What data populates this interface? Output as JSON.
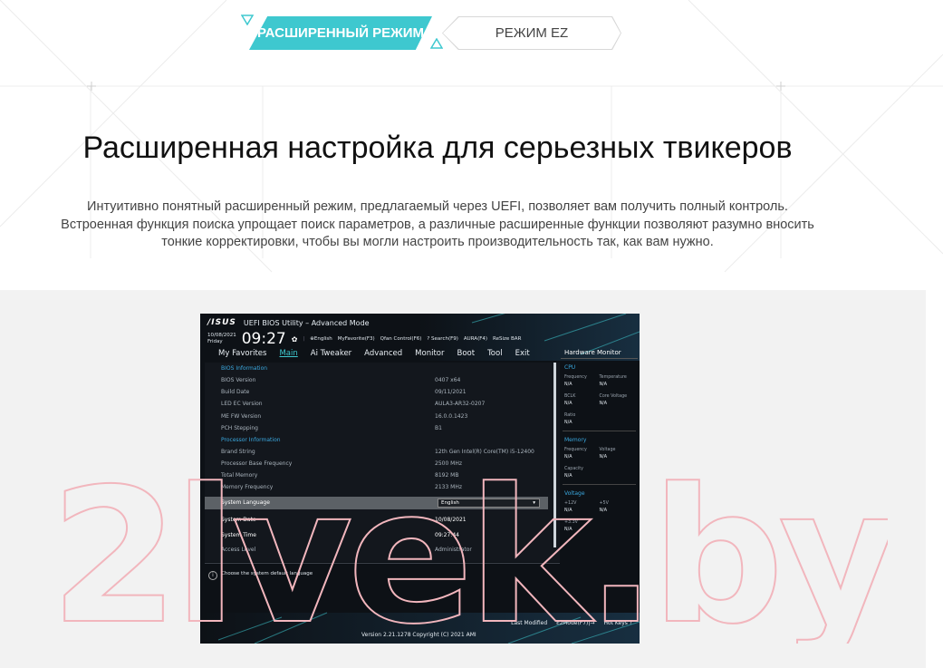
{
  "tabs": {
    "advanced_label": "РАСШИРЕННЫЙ РЕЖИМ",
    "ez_label": "РЕЖИМ EZ"
  },
  "headline": "Расширенная настройка для серьезных твикеров",
  "description": {
    "line1": "Интуитивно понятный расширенный режим, предлагаемый через UEFI, позволяет вам получить полный контроль.",
    "line2": "Встроенная функция поиска упрощает поиск параметров, а различные расширенные функции позволяют разумно вносить",
    "line3": "тонкие корректировки, чтобы вы могли настроить производительность так, как вам нужно."
  },
  "bios": {
    "brand": "/ISUS",
    "title": "UEFI BIOS Utility – Advanced Mode",
    "date": "10/08/2021",
    "weekday": "Friday",
    "clock": "09:27",
    "toolbar": [
      "⊕English",
      "MyFavorite(F3)",
      "Qfan Control(F6)",
      "? Search(F9)",
      "AURA(F4)",
      "ReSize BAR"
    ],
    "menu": [
      "My Favorites",
      "Main",
      "Ai Tweaker",
      "Advanced",
      "Monitor",
      "Boot",
      "Tool",
      "Exit"
    ],
    "rows": [
      {
        "k": "BIOS Information",
        "v": ""
      },
      {
        "k": "BIOS Version",
        "v": "0407 x64"
      },
      {
        "k": "Build Date",
        "v": "09/11/2021"
      },
      {
        "k": "LED EC Version",
        "v": "AULA3-AR32-0207"
      },
      {
        "k": "ME FW Version",
        "v": "16.0.0.1423"
      },
      {
        "k": "PCH Stepping",
        "v": "B1"
      },
      {
        "k": "Processor Information",
        "v": ""
      },
      {
        "k": "Brand String",
        "v": "12th Gen Intel(R) Core(TM) i5-12400"
      },
      {
        "k": "Processor Base Frequency",
        "v": "2500 MHz"
      },
      {
        "k": "Total Memory",
        "v": "8192 MB"
      },
      {
        "k": "Memory Frequency",
        "v": "2133 MHz"
      },
      {
        "k": "System Language",
        "v": "English"
      },
      {
        "k": "System Date",
        "v": "10/08/2021"
      },
      {
        "k": "System Time",
        "v": "09:27:44"
      },
      {
        "k": "Access Level",
        "v": "Administrator"
      }
    ],
    "help_text": "Choose the system default language",
    "hw": {
      "title": "Hardware Monitor",
      "cpu": "CPU",
      "frequency": "Frequency",
      "temperature": "Temperature",
      "na": "N/A",
      "bclk": "BCLK",
      "core_voltage": "Core Voltage",
      "ratio": "Ratio",
      "memory": "Memory",
      "voltage_label": "Voltage",
      "capacity": "Capacity",
      "voltage": "Voltage",
      "v12": "+12V",
      "v5": "+5V",
      "v33": "+3.3V"
    },
    "footer": [
      "Last Modified",
      "EzMode(F7)|→",
      "Hot Keys ?"
    ],
    "copyright": "Version 2.21.1278 Copyright (C) 2021 AMI"
  },
  "watermark": "2lvek.by",
  "colors": {
    "accent": "#3ec8cf",
    "watermark": "#f2b6bd"
  }
}
